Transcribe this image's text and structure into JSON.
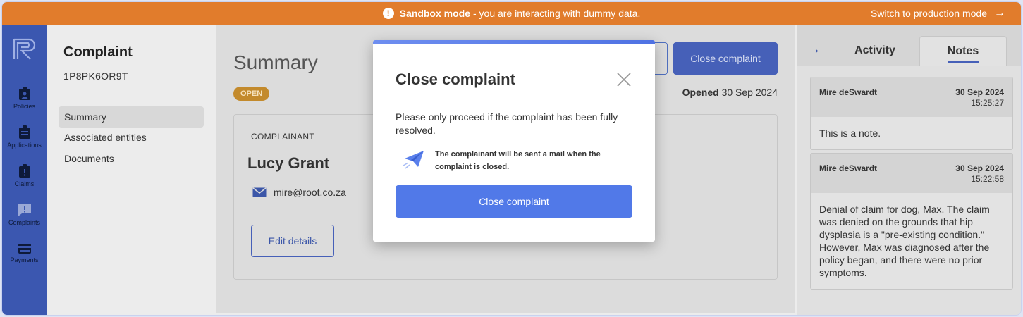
{
  "banner": {
    "mode_label": "Sandbox mode",
    "message": "- you are interacting with dummy data.",
    "warn_glyph": "!",
    "switch_label": "Switch to production mode",
    "switch_arrow": "→",
    "color": "#e17c2c"
  },
  "rail": {
    "items": [
      {
        "label": "Policies",
        "icon": "badge-icon"
      },
      {
        "label": "Applications",
        "icon": "clipboard-icon"
      },
      {
        "label": "Claims",
        "icon": "claim-icon"
      },
      {
        "label": "Complaints",
        "icon": "chat-alert-icon"
      },
      {
        "label": "Payments",
        "icon": "card-icon"
      }
    ],
    "color": "#3b57b0"
  },
  "subnav": {
    "title": "Complaint",
    "complaint_id": "1P8PK6OR9T",
    "items": [
      {
        "label": "Summary",
        "active": true
      },
      {
        "label": "Associated entities",
        "active": false
      },
      {
        "label": "Documents",
        "active": false
      }
    ]
  },
  "main": {
    "heading": "Summary",
    "status_badge": "OPEN",
    "opened_label": "Opened",
    "opened_date": "30 Sep 2024",
    "close_button": "Close complaint",
    "card": {
      "section_label": "COMPLAINANT",
      "name": "Lucy Grant",
      "email": "mire@root.co.za",
      "edit_button": "Edit details"
    }
  },
  "right_panel": {
    "collapse_glyph": "→",
    "tabs": [
      {
        "label": "Activity",
        "active": false
      },
      {
        "label": "Notes",
        "active": true
      }
    ],
    "notes": [
      {
        "author": "Mire deSwardt",
        "date": "30 Sep 2024",
        "time": "15:25:27",
        "body": "This is a note."
      },
      {
        "author": "Mire deSwardt",
        "date": "30 Sep 2024",
        "time": "15:22:58",
        "body": "Denial of claim for dog, Max. The claim was denied on the grounds that hip dysplasia is a \"pre-existing condition.\" However, Max was diagnosed after the policy began, and there were no prior symptoms."
      }
    ]
  },
  "modal": {
    "title": "Close complaint",
    "text": "Please only proceed if the complaint has been fully resolved.",
    "notice": "The complainant will be sent a mail when the complaint is closed.",
    "confirm_button": "Close complaint",
    "accent": "#5179e8"
  }
}
